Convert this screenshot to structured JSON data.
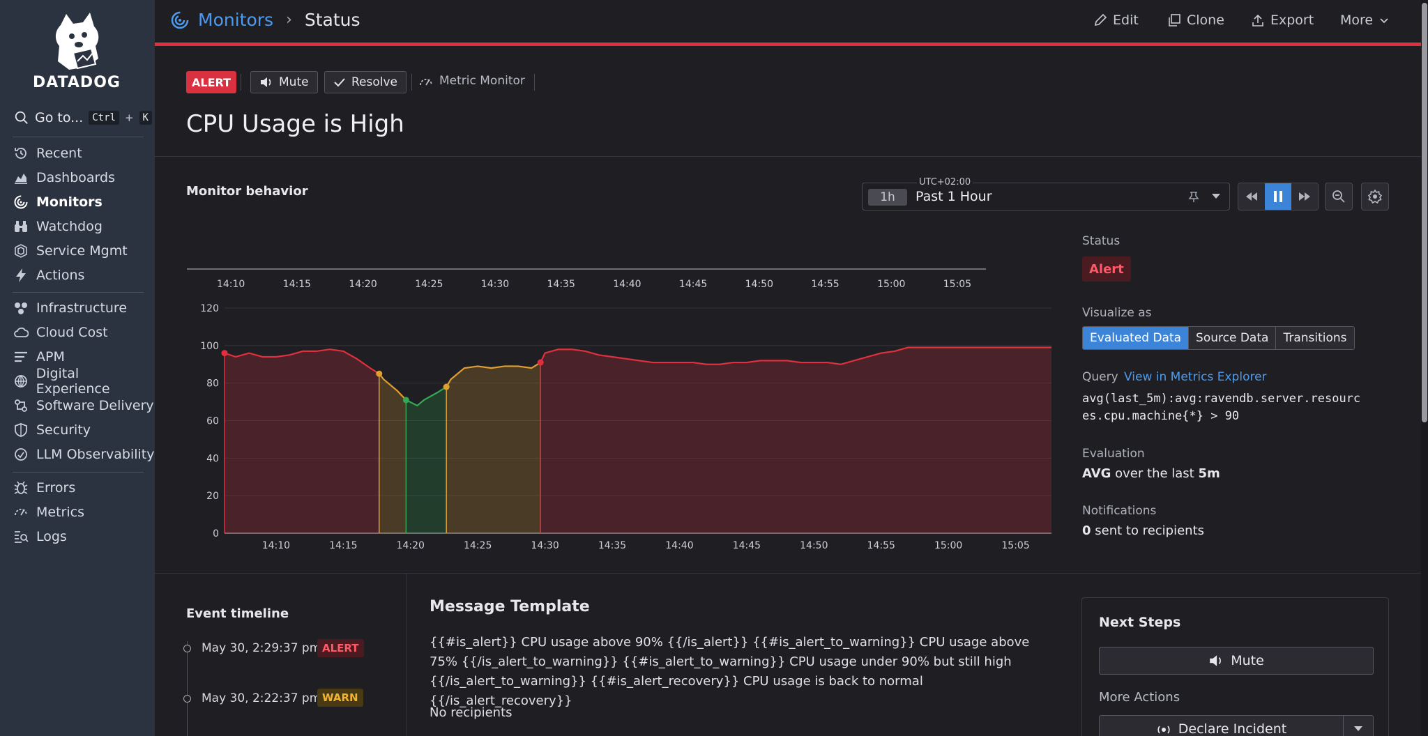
{
  "brand": {
    "name": "DATADOG"
  },
  "sidebar": {
    "goto": {
      "label": "Go to...",
      "key1": "Ctrl",
      "plus": "+",
      "key2": "K"
    },
    "groups": [
      [
        {
          "label": "Recent",
          "icon": "history-icon"
        },
        {
          "label": "Dashboards",
          "icon": "dashboard-chart-icon"
        },
        {
          "label": "Monitors",
          "icon": "monitors-icon",
          "active": true
        },
        {
          "label": "Watchdog",
          "icon": "binoculars-icon"
        },
        {
          "label": "Service Mgmt",
          "icon": "service-mgmt-icon"
        },
        {
          "label": "Actions",
          "icon": "lightning-icon"
        }
      ],
      [
        {
          "label": "Infrastructure",
          "icon": "infrastructure-icon"
        },
        {
          "label": "Cloud Cost",
          "icon": "cloud-icon"
        },
        {
          "label": "APM",
          "icon": "apm-icon"
        },
        {
          "label": "Digital Experience",
          "icon": "digital-experience-icon"
        },
        {
          "label": "Software Delivery",
          "icon": "software-delivery-icon"
        },
        {
          "label": "Security",
          "icon": "shield-icon"
        },
        {
          "label": "LLM Observability",
          "icon": "llm-icon"
        }
      ],
      [
        {
          "label": "Errors",
          "icon": "bug-icon"
        },
        {
          "label": "Metrics",
          "icon": "metrics-gauge-icon"
        },
        {
          "label": "Logs",
          "icon": "logs-icon"
        }
      ]
    ]
  },
  "header": {
    "breadcrumb": {
      "parent": "Monitors",
      "current": "Status"
    },
    "actions": {
      "edit": "Edit",
      "clone": "Clone",
      "export": "Export",
      "more": "More"
    }
  },
  "monitor": {
    "state_badge": "ALERT",
    "mute": "Mute",
    "resolve": "Resolve",
    "type": "Metric Monitor",
    "title": "CPU Usage is High"
  },
  "behavior": {
    "title": "Monitor behavior",
    "timezone": "UTC+02:00",
    "range_short": "1h",
    "range_label": "Past 1 Hour"
  },
  "panel": {
    "status_label": "Status",
    "status_value": "Alert",
    "visualize_label": "Visualize as",
    "visualize_options": [
      "Evaluated Data",
      "Source Data",
      "Transitions"
    ],
    "visualize_selected": "Evaluated Data",
    "query_label": "Query",
    "query_link": "View in Metrics Explorer",
    "query": "avg(last_5m):avg:ravendb.server.resources.cpu.machine{*} > 90",
    "evaluation_label": "Evaluation",
    "evaluation_prefix": "AVG",
    "evaluation_middle": " over the last ",
    "evaluation_window": "5m",
    "notifications_label": "Notifications",
    "notifications_count": "0",
    "notifications_suffix": " sent to recipients"
  },
  "timeline": {
    "title": "Event timeline",
    "events": [
      {
        "time": "May 30, 2:29:37 pm",
        "state": "ALERT"
      },
      {
        "time": "May 30, 2:22:37 pm",
        "state": "WARN"
      }
    ]
  },
  "message": {
    "title": "Message Template",
    "body": "{{#is_alert}} CPU usage above 90% {{/is_alert}} {{#is_alert_to_warning}} CPU usage above 75% {{/is_alert_to_warning}} {{#is_alert_to_warning}} CPU usage under 90% but still high {{/is_alert_to_warning}} {{#is_alert_recovery}} CPU usage is back to normal {{/is_alert_recovery}}",
    "recipients": "No recipients"
  },
  "next_steps": {
    "title": "Next Steps",
    "mute": "Mute",
    "more_actions": "More Actions",
    "declare": "Declare Incident"
  },
  "colors": {
    "alert": "#e0303e",
    "warn": "#e0a030",
    "ok": "#34a853",
    "accent": "#3c84d8",
    "link": "#4c9bf0"
  },
  "chart_data": {
    "type": "area",
    "x_ticks_top": [
      "14:10",
      "14:15",
      "14:20",
      "14:25",
      "14:30",
      "14:35",
      "14:40",
      "14:45",
      "14:50",
      "14:55",
      "15:00",
      "15:05"
    ],
    "x_ticks": [
      "14:10",
      "14:15",
      "14:20",
      "14:25",
      "14:30",
      "14:35",
      "14:40",
      "14:45",
      "14:50",
      "14:55",
      "15:00",
      "15:05"
    ],
    "y_ticks": [
      0,
      20,
      40,
      60,
      80,
      100,
      120
    ],
    "ylim": [
      0,
      120
    ],
    "xlim_minutes": [
      "14:06:10",
      "15:07:40"
    ],
    "series": [
      {
        "x": [
          "14:06:10",
          "14:07",
          "14:08",
          "14:09",
          "14:10",
          "14:11",
          "14:12",
          "14:13",
          "14:14",
          "14:15",
          "14:16",
          "14:17",
          "14:17:40",
          "14:18",
          "14:19",
          "14:19:40",
          "14:20:30",
          "14:21",
          "14:22",
          "14:22:40",
          "14:23",
          "14:24",
          "14:25",
          "14:26",
          "14:27",
          "14:28",
          "14:29",
          "14:29:40",
          "14:30",
          "14:31",
          "14:32",
          "14:33",
          "14:34",
          "14:35",
          "14:36",
          "14:37",
          "14:38",
          "14:39",
          "14:40",
          "14:41",
          "14:42",
          "14:43",
          "14:44",
          "14:45",
          "14:46",
          "14:47",
          "14:48",
          "14:49",
          "14:50",
          "14:51",
          "14:52",
          "14:53",
          "14:54",
          "14:55",
          "14:56",
          "14:57",
          "14:58",
          "14:59",
          "15:00",
          "15:01",
          "15:02",
          "15:03",
          "15:04",
          "15:05",
          "15:06",
          "15:07:40"
        ],
        "y": [
          96,
          94,
          96,
          94,
          94,
          95,
          97,
          97,
          98,
          97,
          93,
          88,
          85,
          82,
          76,
          71,
          68,
          71,
          75,
          78,
          82,
          88,
          89,
          88,
          89,
          89,
          88,
          91,
          96,
          98,
          98,
          97,
          95,
          94,
          93,
          92,
          91,
          91,
          91,
          91,
          90,
          90,
          91,
          91,
          92,
          92,
          92,
          91,
          91,
          91,
          90,
          92,
          94,
          96,
          97,
          99,
          99,
          99,
          99,
          99,
          99,
          99,
          99,
          99,
          99,
          99
        ],
        "states": [
          "alert",
          "alert",
          "alert",
          "alert",
          "alert",
          "alert",
          "alert",
          "alert",
          "alert",
          "alert",
          "alert",
          "alert",
          "warn",
          "warn",
          "warn",
          "ok",
          "ok",
          "ok",
          "ok",
          "warn",
          "warn",
          "warn",
          "warn",
          "warn",
          "warn",
          "warn",
          "warn",
          "alert",
          "alert",
          "alert",
          "alert",
          "alert",
          "alert",
          "alert",
          "alert",
          "alert",
          "alert",
          "alert",
          "alert",
          "alert",
          "alert",
          "alert",
          "alert",
          "alert",
          "alert",
          "alert",
          "alert",
          "alert",
          "alert",
          "alert",
          "alert",
          "alert",
          "alert",
          "alert",
          "alert",
          "alert",
          "alert",
          "alert",
          "alert",
          "alert",
          "alert",
          "alert",
          "alert",
          "alert",
          "alert",
          "alert"
        ]
      }
    ],
    "transitions": [
      {
        "x": "14:06:10",
        "y": 96,
        "state": "alert"
      },
      {
        "x": "14:17:40",
        "y": 85,
        "state": "warn"
      },
      {
        "x": "14:19:40",
        "y": 71,
        "state": "ok"
      },
      {
        "x": "14:22:40",
        "y": 78,
        "state": "warn"
      },
      {
        "x": "14:29:40",
        "y": 91,
        "state": "alert"
      }
    ],
    "grid": true
  }
}
